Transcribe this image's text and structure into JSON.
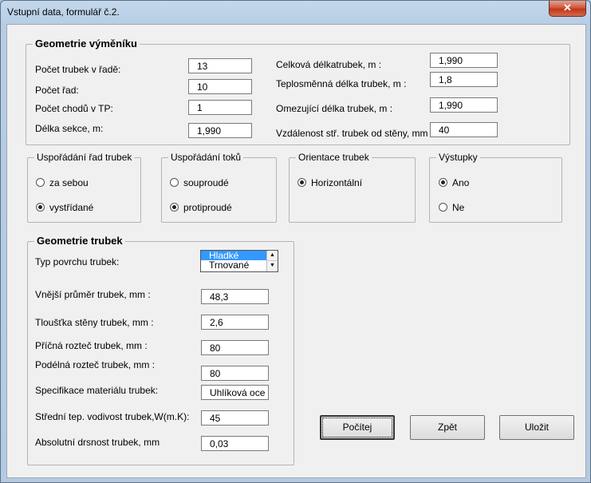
{
  "window": {
    "title": "Vstupní data, formulář č.2.",
    "close_glyph": "✕"
  },
  "geom_vymeniku": {
    "legend": "Geometrie výměníku",
    "left": [
      {
        "label": "Počet trubek v řadě:",
        "value": "13"
      },
      {
        "label": "Počet řad:",
        "value": "10"
      },
      {
        "label": "Počet chodů v TP:",
        "value": "1"
      },
      {
        "label": "Délka sekce, m:",
        "value": "1,990"
      }
    ],
    "right": [
      {
        "label": "Celková délkatrubek, m :",
        "value": "1,990"
      },
      {
        "label": "Teplosměnná délka trubek, m :",
        "value": "1,8"
      },
      {
        "label": "Omezující délka trubek, m :",
        "value": "1,990"
      },
      {
        "label": "Vzdálenost stř. trubek od stěny, mm :",
        "value": "40"
      }
    ]
  },
  "usporadani_rad": {
    "legend": "Uspořádání řad trubek",
    "options": [
      "za sebou",
      "vystřídané"
    ],
    "selected": 1
  },
  "usporadani_toku": {
    "legend": "Uspořádání toků",
    "options": [
      "souproudé",
      "protiproudé"
    ],
    "selected": 1
  },
  "orientace": {
    "legend": "Orientace trubek",
    "options": [
      "Horizontální"
    ],
    "selected": 0
  },
  "vystupky": {
    "legend": "Výstupky",
    "options": [
      "Ano",
      "Ne"
    ],
    "selected": 0
  },
  "geom_trubek": {
    "legend": "Geometrie trubek",
    "typ_label": "Typ povrchu trubek:",
    "typ_options": [
      "Hladké",
      "Trnované"
    ],
    "typ_selected": 0,
    "fields": [
      {
        "label": "Vnější průměr trubek, mm :",
        "value": "48,3"
      },
      {
        "label": "Tloušťka stěny trubek, mm :",
        "value": "2,6"
      },
      {
        "label": "Příčná rozteč trubek, mm :",
        "value": "80"
      },
      {
        "label": "Podélná rozteč trubek, mm :",
        "value": "80"
      },
      {
        "label": "Specifikace materiálu trubek:",
        "value": "Uhlíková oce"
      },
      {
        "label": "Střední tep. vodivost trubek,W(m.K):",
        "value": "45"
      },
      {
        "label": "Absolutní drsnost trubek, mm",
        "value": "0,03"
      }
    ]
  },
  "buttons": {
    "pocitej": "Počítej",
    "zpet": "Zpět",
    "ulozit": "Uložit"
  },
  "scroll_up_glyph": "▲",
  "scroll_down_glyph": "▼"
}
